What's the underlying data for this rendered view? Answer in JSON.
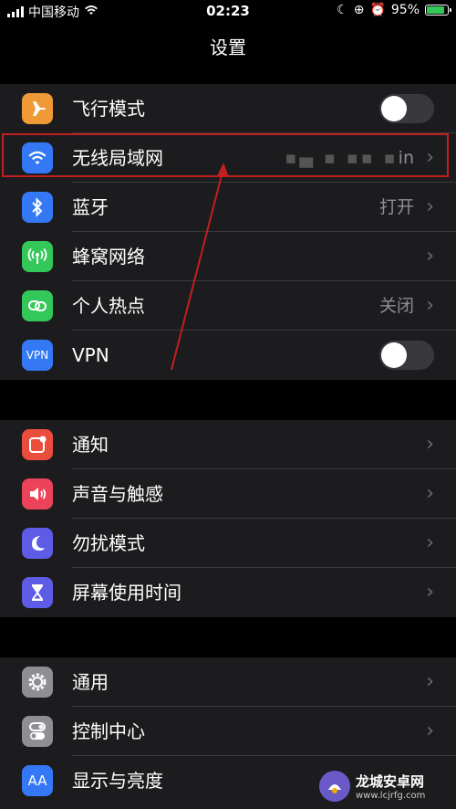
{
  "status_bar": {
    "carrier": "中国移动",
    "time": "02:23",
    "battery_percent": "95%",
    "battery_level": 0.95,
    "battery_color": "#34c759"
  },
  "header": {
    "title": "设置"
  },
  "groups": [
    {
      "rows": [
        {
          "label": "飞行模式",
          "icon": "airplane-icon",
          "icon_color": "#f09a37",
          "control": "toggle",
          "toggle_on": false
        },
        {
          "label": "无线局域网",
          "icon": "wifi-icon",
          "icon_color": "#3478f6",
          "value": "in",
          "control": "chevron"
        },
        {
          "label": "蓝牙",
          "icon": "bluetooth-icon",
          "icon_color": "#3478f6",
          "value": "打开",
          "control": "chevron"
        },
        {
          "label": "蜂窝网络",
          "icon": "cellular-icon",
          "icon_color": "#34c759",
          "control": "chevron"
        },
        {
          "label": "个人热点",
          "icon": "hotspot-icon",
          "icon_color": "#34c759",
          "value": "关闭",
          "control": "chevron"
        },
        {
          "label": "VPN",
          "icon": "vpn-icon",
          "icon_text": "VPN",
          "icon_color": "#3478f6",
          "control": "toggle",
          "toggle_on": false
        }
      ]
    },
    {
      "rows": [
        {
          "label": "通知",
          "icon": "notifications-icon",
          "icon_color": "#eb4d3d",
          "control": "chevron"
        },
        {
          "label": "声音与触感",
          "icon": "sound-icon",
          "icon_color": "#eb445a",
          "control": "chevron"
        },
        {
          "label": "勿扰模式",
          "icon": "moon-icon",
          "icon_color": "#5e5ce6",
          "control": "chevron"
        },
        {
          "label": "屏幕使用时间",
          "icon": "hourglass-icon",
          "icon_color": "#5e5ce6",
          "control": "chevron"
        }
      ]
    },
    {
      "rows": [
        {
          "label": "通用",
          "icon": "gear-icon",
          "icon_color": "#8e8e93",
          "control": "chevron"
        },
        {
          "label": "控制中心",
          "icon": "switches-icon",
          "icon_color": "#8e8e93",
          "control": "chevron"
        },
        {
          "label": "显示与亮度",
          "icon": "display-icon",
          "icon_text": "AA",
          "icon_color": "#3478f6",
          "control": "chevron"
        }
      ]
    }
  ],
  "annotation": {
    "highlight_color": "#c0201f",
    "arrow_color": "#c0201f"
  },
  "watermark": {
    "text": "龙城安卓网",
    "url": "www.lcjrfg.com"
  }
}
